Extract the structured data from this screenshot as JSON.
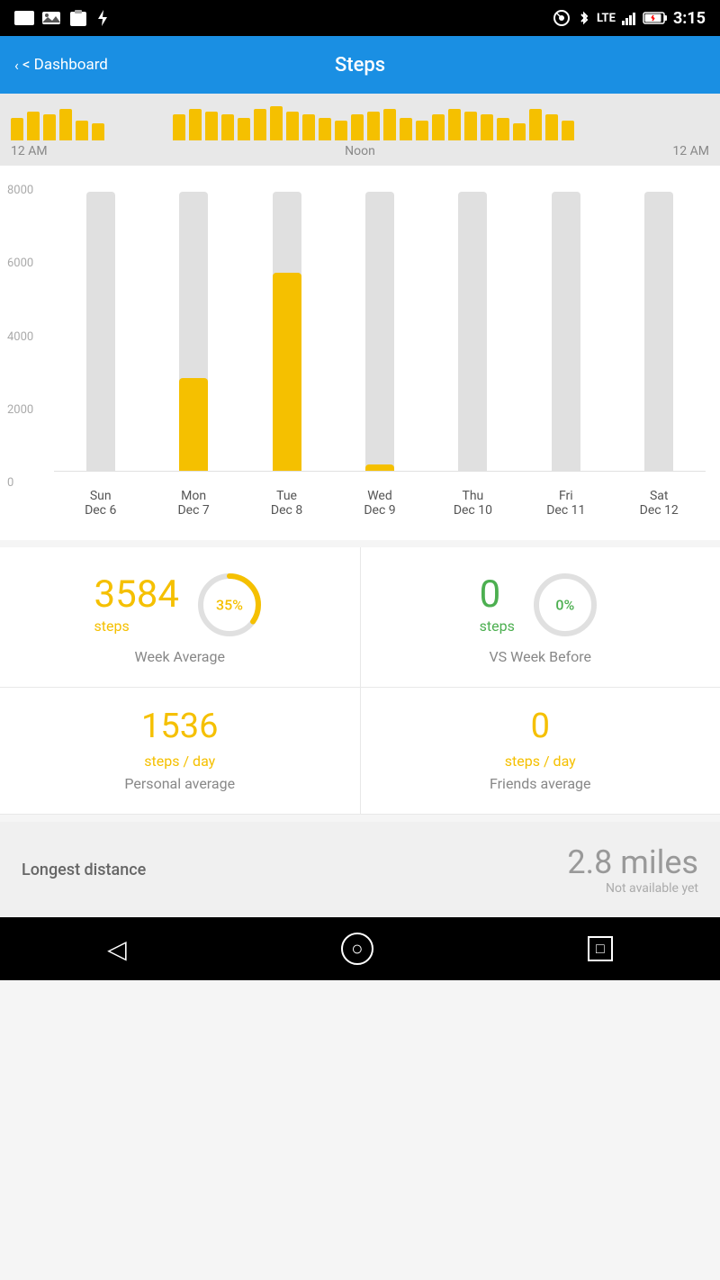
{
  "statusBar": {
    "time": "3:15",
    "icons": [
      "screenshot",
      "image",
      "clipboard",
      "bolt",
      "wifi",
      "bluetooth",
      "lte",
      "signal",
      "battery"
    ]
  },
  "header": {
    "back_label": "< Dashboard",
    "title": "Steps"
  },
  "timeline": {
    "label_left": "12 AM",
    "label_center": "Noon",
    "label_right": "12 AM",
    "bars": [
      8,
      10,
      9,
      11,
      7,
      6,
      0,
      0,
      0,
      0,
      9,
      11,
      10,
      9,
      8,
      11,
      12,
      10,
      9,
      8,
      7,
      9,
      10,
      11,
      8,
      7,
      9,
      11,
      10,
      9,
      8,
      6,
      11,
      9,
      7
    ]
  },
  "weekChart": {
    "yAxis": [
      "0",
      "2000",
      "4000",
      "6000",
      "8000"
    ],
    "bars": [
      {
        "day": "Sun",
        "date": "Dec 6",
        "value": 0,
        "maxValue": 9000
      },
      {
        "day": "Mon",
        "date": "Dec 7",
        "value": 3000,
        "maxValue": 9000
      },
      {
        "day": "Tue",
        "date": "Dec 8",
        "value": 6400,
        "maxValue": 9000
      },
      {
        "day": "Wed",
        "date": "Dec 9",
        "value": 200,
        "maxValue": 9000
      },
      {
        "day": "Thu",
        "date": "Dec 10",
        "value": 0,
        "maxValue": 9000
      },
      {
        "day": "Fri",
        "date": "Dec 11",
        "value": 0,
        "maxValue": 9000
      },
      {
        "day": "Sat",
        "date": "Dec 12",
        "value": 0,
        "maxValue": 9000
      }
    ]
  },
  "weekAverage": {
    "value": "3584",
    "unit": "steps",
    "percent": 35,
    "percent_label": "35%",
    "label": "Week Average"
  },
  "vsWeekBefore": {
    "value": "0",
    "unit": "steps",
    "percent": 0,
    "percent_label": "0%",
    "label": "VS Week Before"
  },
  "personalAverage": {
    "value": "1536",
    "unit": "steps / day",
    "label": "Personal average"
  },
  "friendsAverage": {
    "value": "0",
    "unit": "steps / day",
    "label": "Friends average"
  },
  "longestDistance": {
    "label": "Longest distance",
    "value": "2.8 miles",
    "sub": "Not available yet"
  },
  "nav": {
    "back_icon": "◁",
    "home_icon": "○",
    "recent_icon": "□"
  }
}
